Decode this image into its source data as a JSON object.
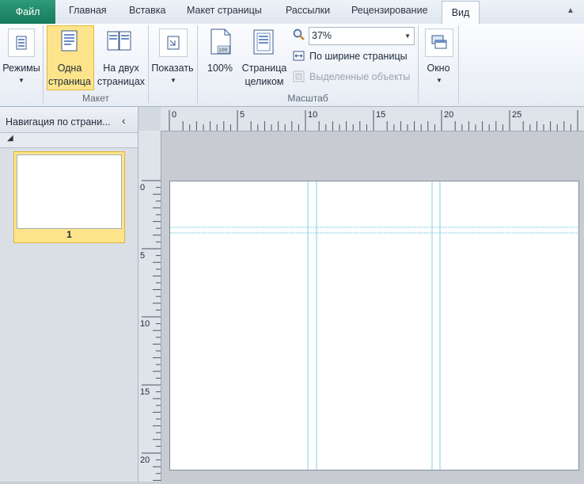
{
  "tabs": {
    "file": "Файл",
    "items": [
      "Главная",
      "Вставка",
      "Макет страницы",
      "Рассылки",
      "Рецензирование"
    ],
    "active": "Вид"
  },
  "ribbon": {
    "modes_label": "Режимы",
    "one_page_label": "Одна\nстраница",
    "two_pages_label": "На двух\nстраницах",
    "group_layout": "Макет",
    "show_label": "Показать",
    "zoom_100_label": "100%",
    "whole_page_label": "Страница\nцеликом",
    "zoom_value": "37%",
    "page_width_label": "По ширине страницы",
    "selected_objects_label": "Выделенные объекты",
    "group_zoom": "Масштаб",
    "window_label": "Окно"
  },
  "nav": {
    "title": "Навигация по страни...",
    "page_number": "1"
  },
  "rulers": {
    "horizontal": [
      "0",
      "5",
      "10",
      "15",
      "20",
      "25"
    ],
    "vertical": [
      "0",
      "5",
      "10",
      "15",
      "20"
    ]
  },
  "colors": {
    "file_tab": "#16795a",
    "selected": "#fde48a",
    "guides": "#7fd3df"
  }
}
